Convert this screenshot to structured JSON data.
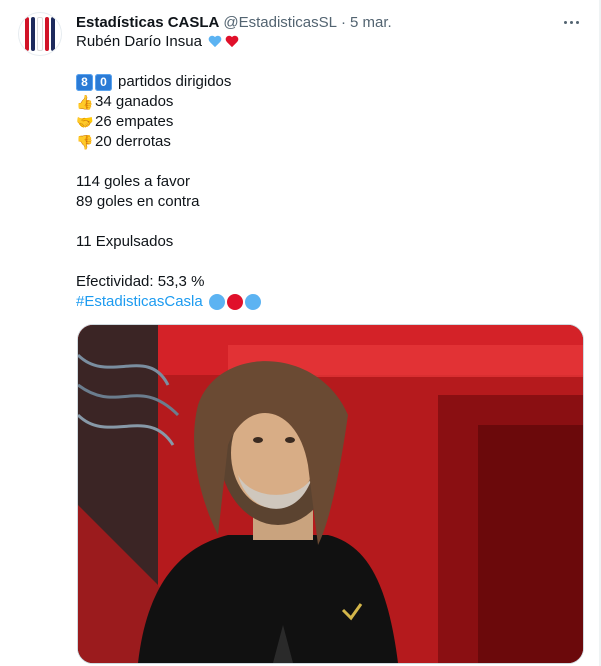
{
  "tweet": {
    "author_name": "Estadísticas CASLA",
    "handle": "@EstadisticasSL",
    "separator": "·",
    "time": "5 mar.",
    "line_title": "Rubén Darío Insua",
    "matches_digit_1": "8",
    "matches_digit_2": "0",
    "matches_text": "partidos dirigidos",
    "wins_emoji": "👍",
    "wins_text": "34 ganados",
    "draws_emoji": "🤝",
    "draws_text": "26 empates",
    "losses_emoji": "👎",
    "losses_text": "20 derrotas",
    "goals_for": "114 goles a favor",
    "goals_against": "89 goles en contra",
    "expulsions": "11 Expulsados",
    "effectiveness": "Efectividad: 53,3 %",
    "hashtag": "#EstadisticasCasla"
  },
  "colors": {
    "accent": "#1d9bf0",
    "heart_blue": "#5cb3f2",
    "heart_red": "#e0102a",
    "text": "#0f1419",
    "muted": "#536471"
  },
  "icons": {
    "more": "more-icon",
    "avatar": "club-avatar-icon"
  }
}
